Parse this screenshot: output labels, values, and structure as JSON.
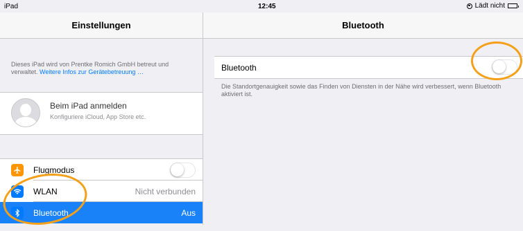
{
  "status_bar": {
    "device": "iPad",
    "time": "12:45",
    "charging": "Lädt nicht"
  },
  "master": {
    "title": "Einstellungen",
    "supervision_text": "Dieses iPad wird von Prentke Romich GmbH betreut und verwaltet.",
    "supervision_link": "Weitere Infos zur Gerätebetreuung …",
    "account": {
      "title": "Beim iPad anmelden",
      "subtitle": "Konfiguriere iCloud, App Store etc."
    },
    "items": [
      {
        "label": "Flugmodus",
        "icon": "airplane-icon",
        "toggle": false
      },
      {
        "label": "WLAN",
        "icon": "wifi-icon",
        "value": "Nicht verbunden"
      },
      {
        "label": "Bluetooth",
        "icon": "bluetooth-icon",
        "value": "Aus",
        "selected": true
      }
    ]
  },
  "detail": {
    "title": "Bluetooth",
    "row_label": "Bluetooth",
    "toggle_on": false,
    "footer": "Die Standortgenauigkeit sowie das Finden von Diensten in der Nähe wird verbessert, wenn Bluetooth aktiviert ist."
  },
  "colors": {
    "accent": "#007aff",
    "selected_row": "#1a82f9",
    "airplane_icon": "#ff9500",
    "annotation": "#f5a01a"
  }
}
